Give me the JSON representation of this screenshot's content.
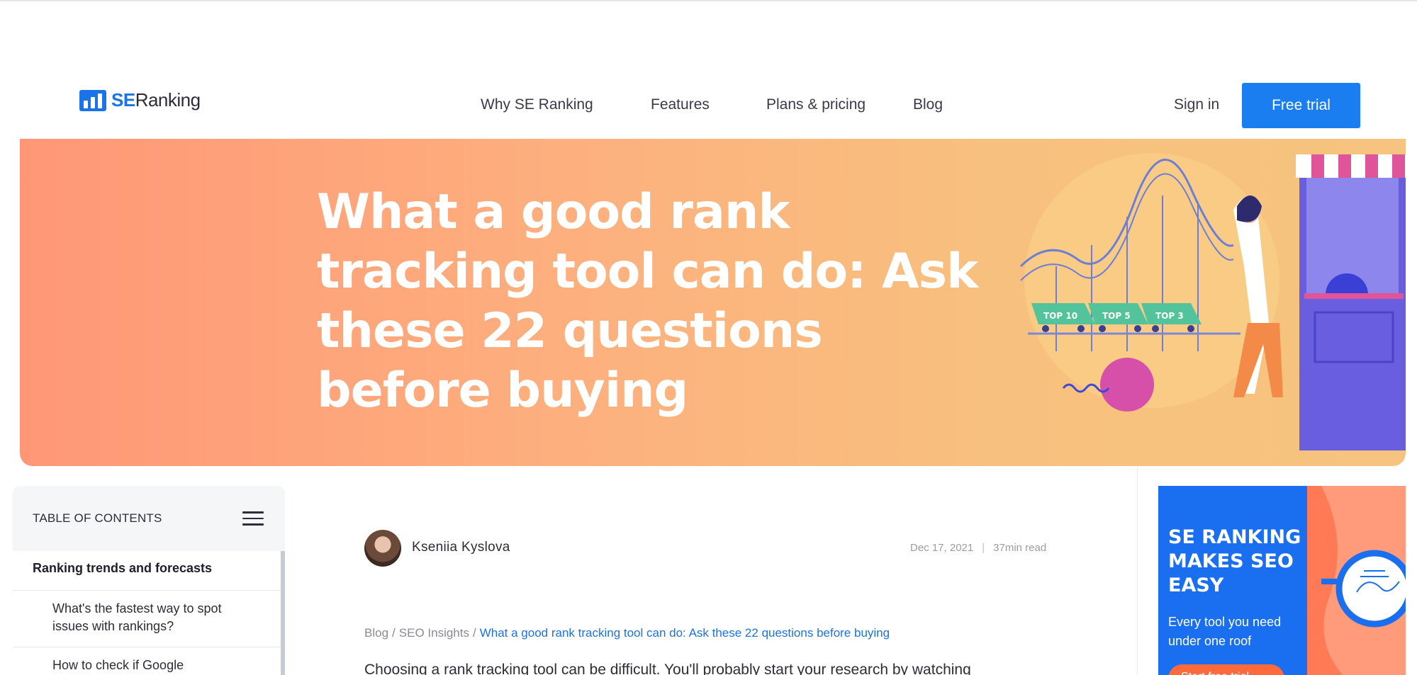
{
  "header": {
    "logo": {
      "se": "SE",
      "ranking": "Ranking"
    },
    "nav": [
      "Why SE Ranking",
      "Features",
      "Plans & pricing",
      "Blog"
    ],
    "signin": "Sign in",
    "cta": "Free trial"
  },
  "hero": {
    "title": "What a good rank tracking tool can do: Ask these 22 questions before buying",
    "cart_labels": [
      "TOP 10",
      "TOP 5",
      "TOP 3"
    ]
  },
  "toc": {
    "heading": "TABLE OF CONTENTS",
    "items": [
      {
        "label": "Ranking trends and forecasts"
      },
      {
        "label": "What's the fastest way to spot issues with rankings?"
      },
      {
        "label": "How to check if Google"
      }
    ]
  },
  "article": {
    "author": "Kseniia Kyslova",
    "date": "Dec 17, 2021",
    "read_time": "37min read",
    "breadcrumb": [
      "Blog",
      "SEO Insights",
      "What a good rank tracking tool can do: Ask these 22 questions before buying"
    ],
    "intro": "Choosing a rank tracking tool can be difficult. You'll probably start your research by watching"
  },
  "ad": {
    "title": "SE RANKING MAKES SEO EASY",
    "subtitle": "Every tool you need under one roof",
    "button": "Start free trial"
  },
  "colors": {
    "brand_blue": "#1a73e8",
    "hero_start": "#ff9777",
    "hero_end": "#f6c47e",
    "ad_orange": "#ff6a3d"
  }
}
